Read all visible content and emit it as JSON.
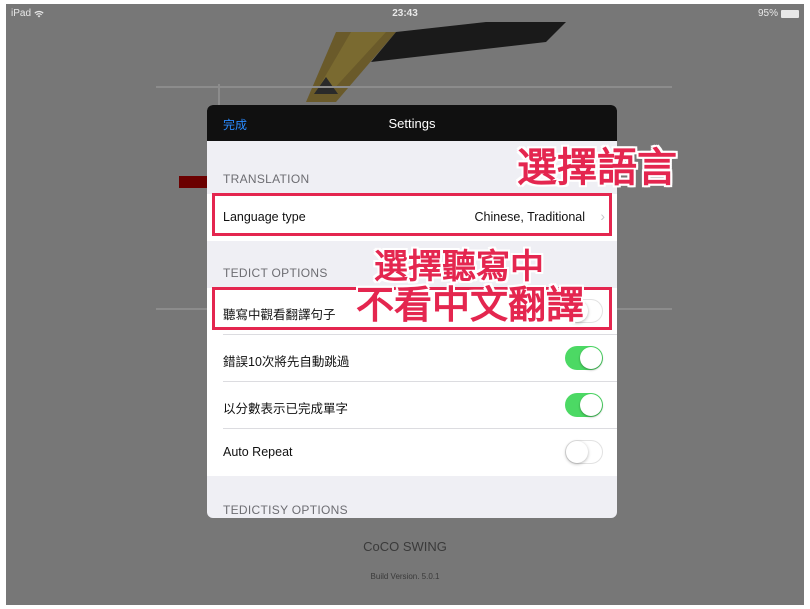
{
  "status_bar": {
    "device": "iPad",
    "wifi_icon": "wifi-icon",
    "time": "23:43",
    "battery": "95%",
    "battery_icon": "battery-icon"
  },
  "background": {
    "brand": "CoCO SWING",
    "build_version": "Build Version. 5.0.1"
  },
  "settings": {
    "done_label": "完成",
    "title": "Settings",
    "sections": [
      {
        "header": "TRANSLATION",
        "rows": [
          {
            "label": "Language type",
            "value": "Chinese, Traditional",
            "kind": "disclosure"
          }
        ]
      },
      {
        "header": "TEDICT OPTIONS",
        "rows": [
          {
            "label": "聽寫中觀看翻譯句子",
            "kind": "toggle",
            "on": false
          },
          {
            "label": "錯誤10次將先自動跳過",
            "kind": "toggle",
            "on": true
          },
          {
            "label": "以分數表示已完成單字",
            "kind": "toggle",
            "on": true
          },
          {
            "label": "Auto Repeat",
            "kind": "toggle",
            "on": false
          }
        ]
      },
      {
        "header": "TEDICTISY OPTIONS",
        "rows": []
      }
    ]
  },
  "annotations": {
    "language_note": "選擇語言",
    "dictation_note_line1": "選擇聽寫中",
    "dictation_note_line2": "不看中文翻譯",
    "color": "#e4264f"
  },
  "colors": {
    "accent": "#2a8bff",
    "toggle_on": "#4cd964",
    "nav_bar": "#101010",
    "dim_background": "#777777"
  }
}
